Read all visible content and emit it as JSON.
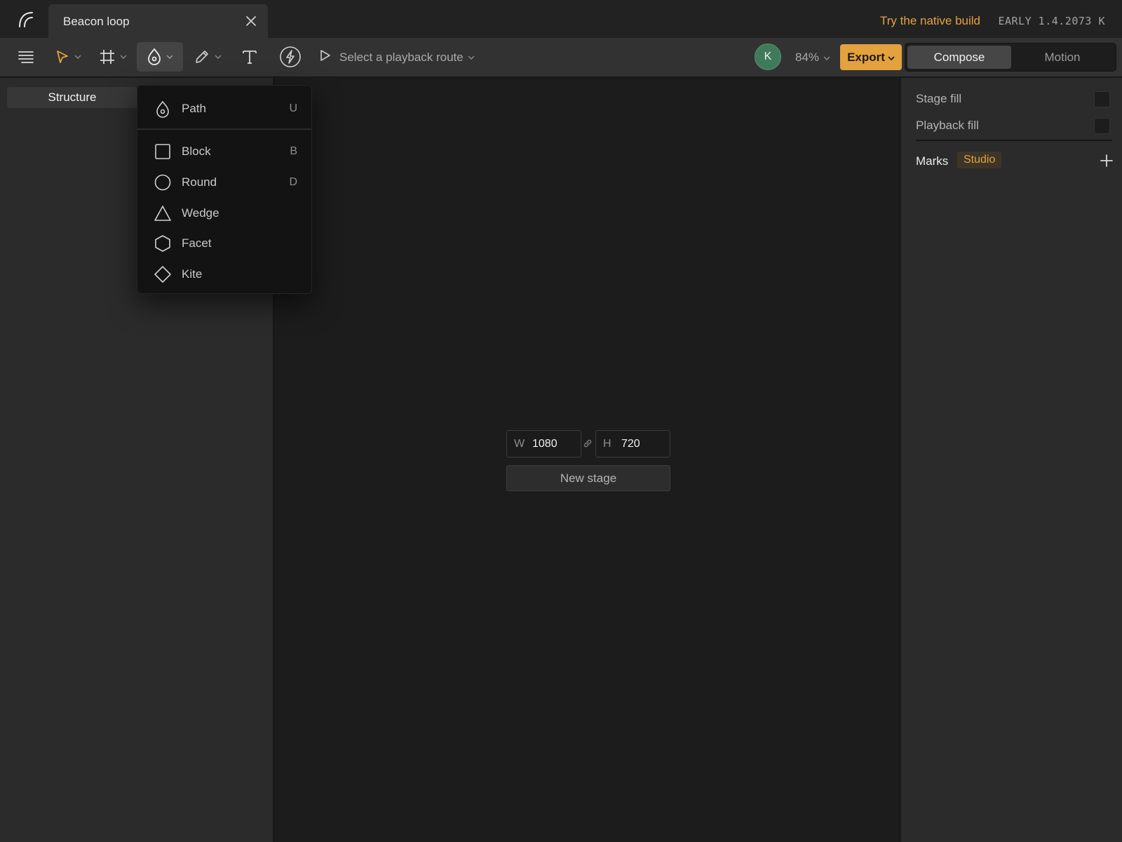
{
  "titlebar": {
    "tab_title": "Beacon loop",
    "native_link": "Try the native build",
    "build_info": "EARLY 1.4.2073 K"
  },
  "toolbar": {
    "tools": [
      "menu-icon",
      "select-arrow-icon",
      "frame-icon",
      "pen-shape-icon",
      "pencil-icon",
      "text-icon",
      "bolt-icon"
    ],
    "playback_label": "Select a playback route",
    "avatar_initial": "K",
    "zoom": "84%",
    "export_label": "Export",
    "modes": {
      "compose": "Compose",
      "motion": "Motion",
      "active": "Compose"
    },
    "accent_color": "#e3a23d"
  },
  "left_panel": {
    "tab_label": "Structure"
  },
  "shape_menu": {
    "items": [
      {
        "label": "Path",
        "shortcut": "U",
        "icon": "path-drop-icon"
      },
      {
        "label": "Block",
        "shortcut": "B",
        "icon": "square-icon"
      },
      {
        "label": "Round",
        "shortcut": "D",
        "icon": "circle-icon"
      },
      {
        "label": "Wedge",
        "shortcut": "",
        "icon": "triangle-icon"
      },
      {
        "label": "Facet",
        "shortcut": "",
        "icon": "hexagon-icon"
      },
      {
        "label": "Kite",
        "shortcut": "",
        "icon": "diamond-icon"
      }
    ]
  },
  "canvas": {
    "width_letter": "W",
    "width_value": "1080",
    "height_letter": "H",
    "height_value": "720",
    "new_stage_label": "New stage"
  },
  "right_panel": {
    "stage_fill_label": "Stage fill",
    "playback_fill_label": "Playback fill",
    "marks_title": "Marks",
    "marks_badge": "Studio"
  }
}
